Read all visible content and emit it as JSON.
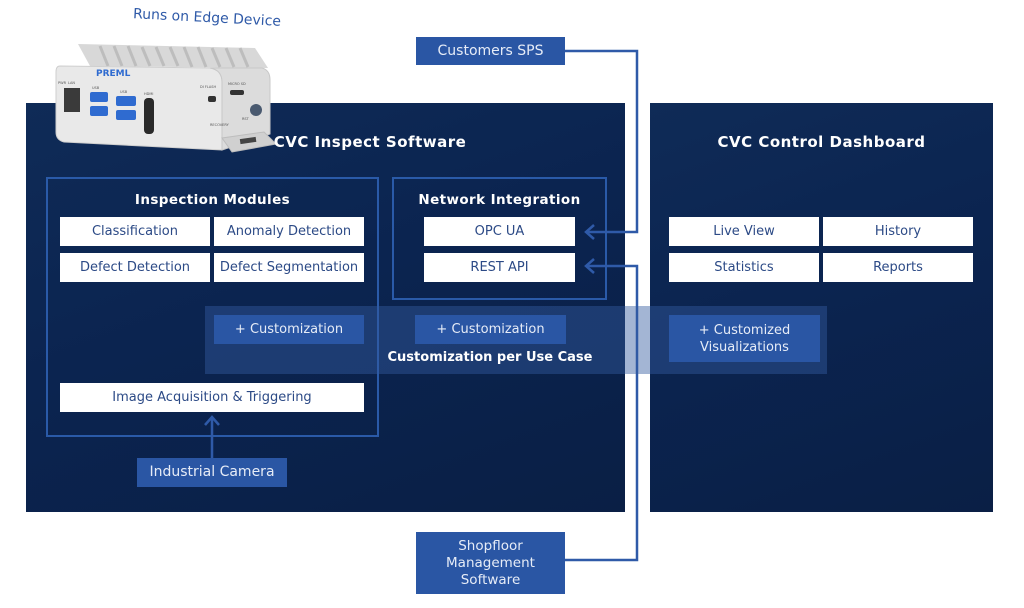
{
  "device": {
    "caption": "Runs on Edge Device",
    "brand": "PREML",
    "port_labels": [
      "PWR",
      "LAN",
      "USB",
      "USB",
      "HDMI",
      "DI FLASH",
      "MICRO SD",
      "RECOVERY",
      "RST"
    ]
  },
  "external": {
    "customers_sps": "Customers SPS",
    "shopfloor": [
      "Shopfloor",
      "Management",
      "Software"
    ],
    "industrial_camera": "Industrial Camera"
  },
  "inspect": {
    "title": "CVC Inspect Software",
    "modules": {
      "title": "Inspection Modules",
      "items": [
        "Classification",
        "Anomaly Detection",
        "Defect Detection",
        "Defect Segmentation"
      ]
    },
    "network": {
      "title": "Network Integration",
      "items": [
        "OPC UA",
        "REST API"
      ]
    },
    "acquisition": "Image Acquisition & Triggering"
  },
  "dashboard": {
    "title": "CVC Control Dashboard",
    "items": [
      "Live View",
      "History",
      "Statistics",
      "Reports"
    ]
  },
  "customization": {
    "label": "Customization per Use Case",
    "modules_custom": "+ Customization",
    "network_custom": "+ Customization",
    "dashboard_custom": [
      "+ Customized",
      "Visualizations"
    ]
  },
  "colors": {
    "panel": "#0b2450",
    "accent": "#2a56a4",
    "line": "#2f5aa8",
    "box_text": "#2c4a86"
  }
}
